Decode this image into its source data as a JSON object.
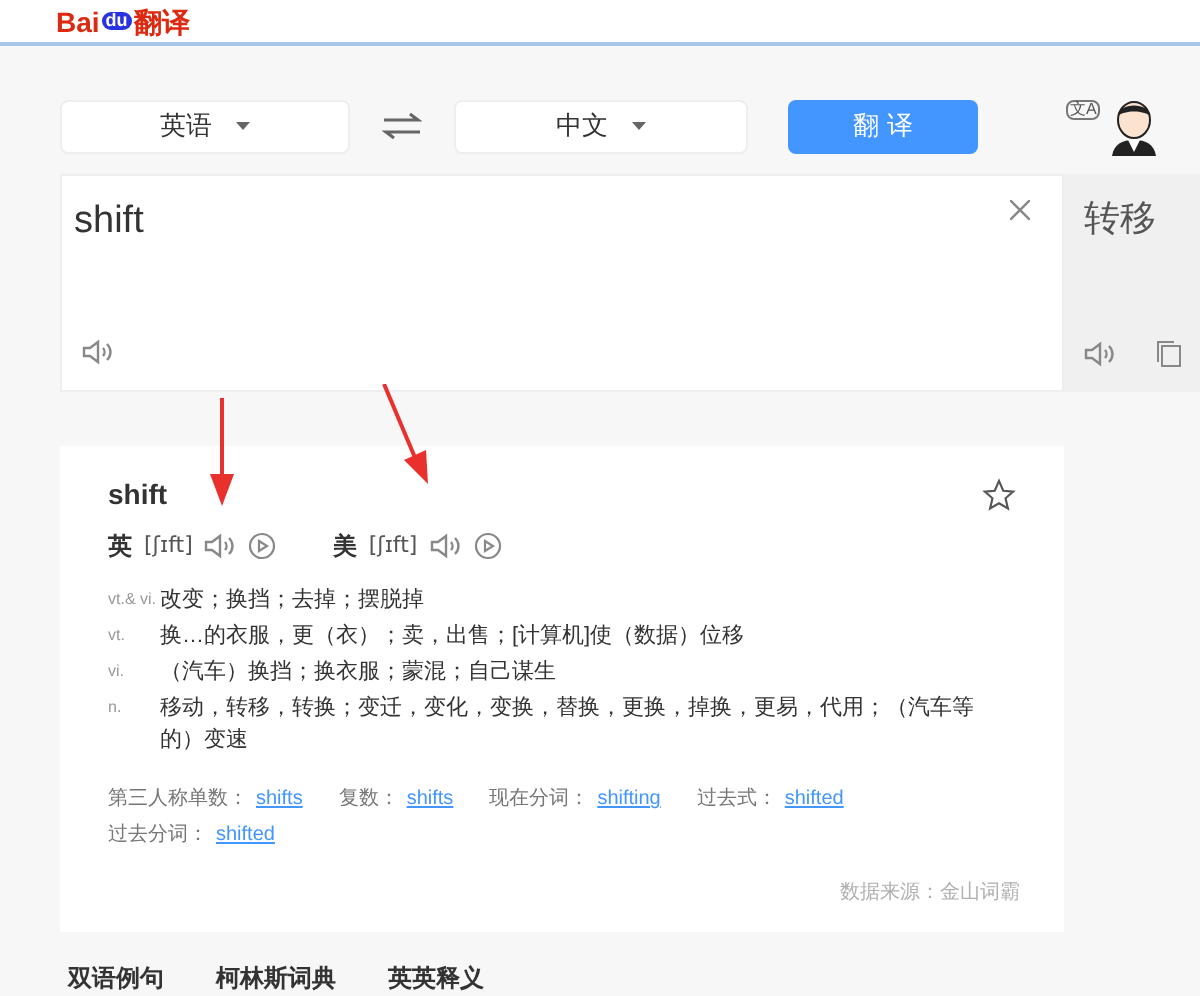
{
  "header": {
    "logo_text": "Bai",
    "logo_paw": "du",
    "logo_suffix": "翻译"
  },
  "languages": {
    "source": "英语",
    "target": "中文",
    "translate_button": "翻 译"
  },
  "user": {
    "icon_label": "文A"
  },
  "input": {
    "value": "shift"
  },
  "output": {
    "text": "转移"
  },
  "dictionary": {
    "word": "shift",
    "starred": false,
    "pronunciations": [
      {
        "region": "英",
        "phonetic": "[ʃɪft]"
      },
      {
        "region": "美",
        "phonetic": "[ʃɪft]"
      }
    ],
    "definitions": [
      {
        "pos": "vt.& vi.",
        "meaning": "改变；换挡；去掉；摆脱掉"
      },
      {
        "pos": "vt.",
        "meaning": "换…的衣服，更（衣）；卖，出售；[计算机]使（数据）位移"
      },
      {
        "pos": "vi.",
        "meaning": "（汽车）换挡；换衣服；蒙混；自己谋生"
      },
      {
        "pos": "n.",
        "meaning": "移动，转移，转换；变迁，变化，变换，替换，更换，掉换，更易，代用；（汽车等的）变速"
      }
    ],
    "forms": [
      {
        "label": "第三人称单数：",
        "word": "shifts"
      },
      {
        "label": "复数：",
        "word": "shifts"
      },
      {
        "label": "现在分词：",
        "word": "shifting"
      },
      {
        "label": "过去式：",
        "word": "shifted"
      },
      {
        "label": "过去分词：",
        "word": "shifted"
      }
    ],
    "source": "数据来源：金山词霸"
  },
  "tabs": [
    {
      "label": "双语例句",
      "selected": false
    },
    {
      "label": "柯林斯词典",
      "selected": false
    },
    {
      "label": "英英释义",
      "selected": false
    }
  ]
}
